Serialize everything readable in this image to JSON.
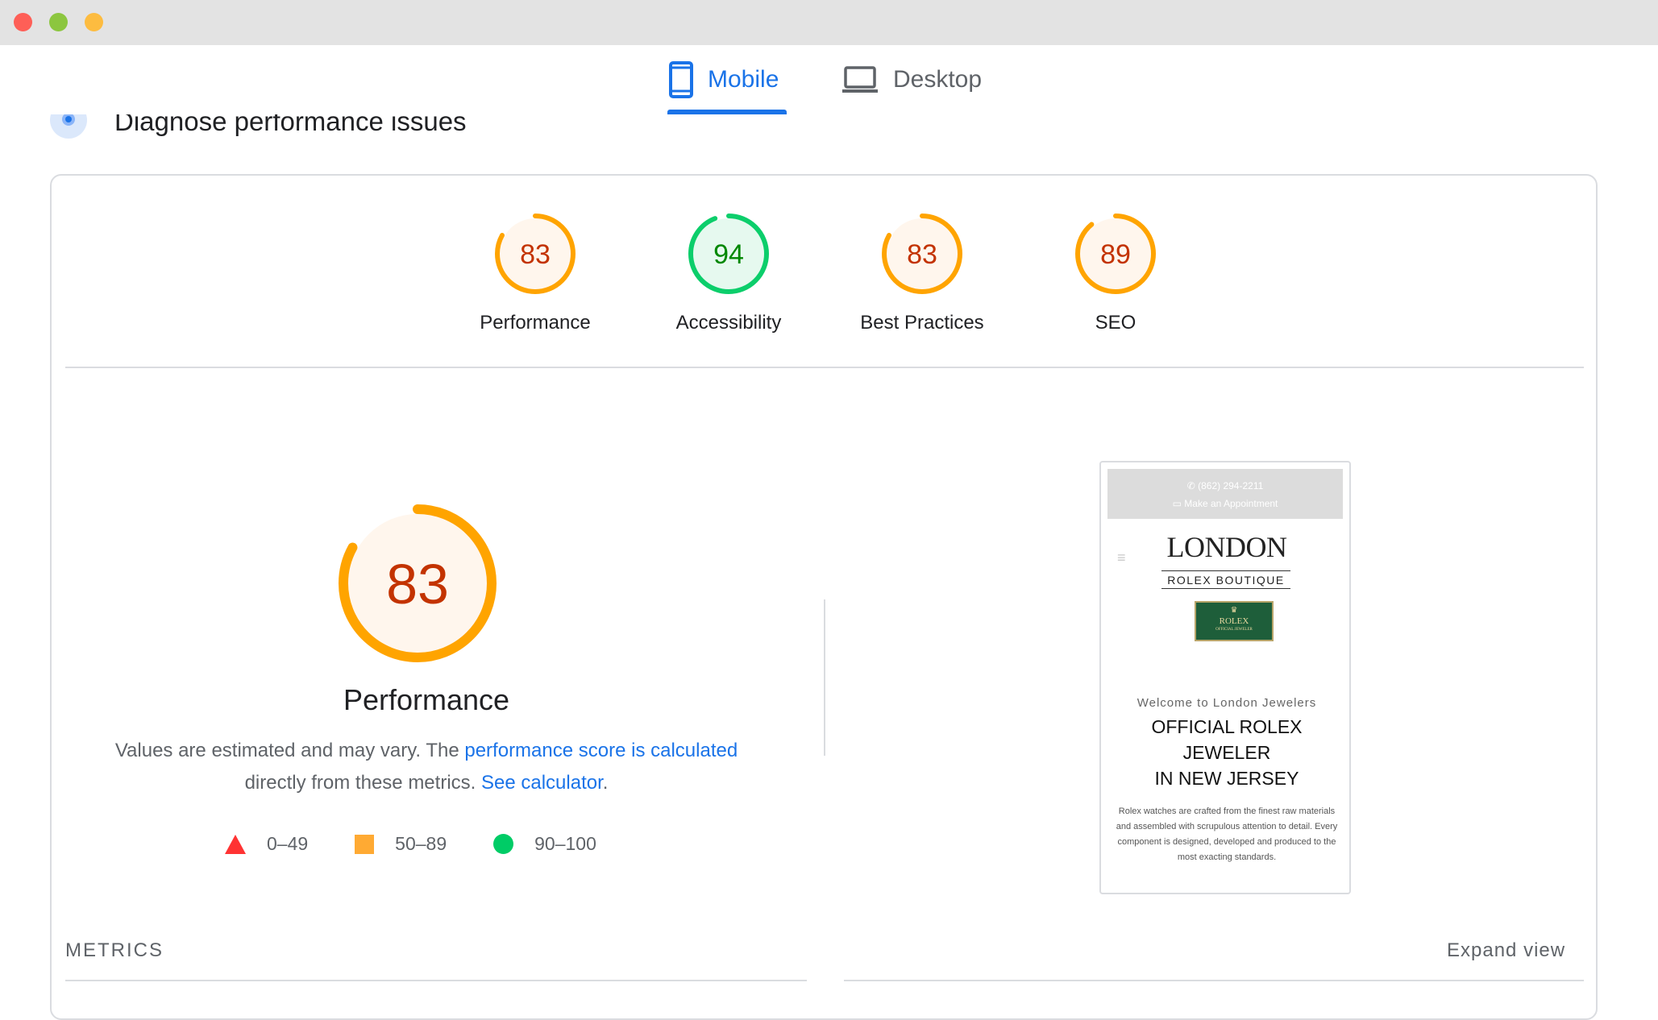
{
  "window": {
    "traffic_lights": [
      "close",
      "minimize",
      "maximize"
    ]
  },
  "tabs": [
    {
      "label": "Mobile",
      "icon": "mobile-phone-icon",
      "active": true
    },
    {
      "label": "Desktop",
      "icon": "laptop-icon",
      "active": false
    }
  ],
  "section": {
    "title": "Diagnose performance issues",
    "icon": "pulse-dot-icon"
  },
  "scores": [
    {
      "label": "Performance",
      "value": "83",
      "score": 83,
      "rating": "average"
    },
    {
      "label": "Accessibility",
      "value": "94",
      "score": 94,
      "rating": "pass"
    },
    {
      "label": "Best Practices",
      "value": "83",
      "score": 83,
      "rating": "average"
    },
    {
      "label": "SEO",
      "value": "89",
      "score": 89,
      "rating": "average"
    }
  ],
  "performance": {
    "value": "83",
    "score": 83,
    "title": "Performance",
    "desc_prefix": "Values are estimated and may vary. The ",
    "desc_link": "performance score is calculated",
    "desc_middle": " directly from these metrics. ",
    "calc_link": "See calculator",
    "desc_suffix": "."
  },
  "legend": [
    {
      "range": "0–49",
      "shape": "triangle",
      "color": "#ff3333"
    },
    {
      "range": "50–89",
      "shape": "square",
      "color": "#ffaa33"
    },
    {
      "range": "90–100",
      "shape": "circle",
      "color": "#00cc66"
    }
  ],
  "colors": {
    "accent": "#1a73e8",
    "average_stroke": "#ffa400",
    "average_text": "#c33300",
    "average_fill": "#fff6ed",
    "pass_stroke": "#0cce6b",
    "pass_text": "#008800",
    "pass_fill": "#e6f9ef"
  },
  "preview": {
    "phone": "(862) 294-2211",
    "appointment": "Make an Appointment",
    "logo_main": "LONDON",
    "logo_sub": "ROLEX BOUTIQUE",
    "badge_name": "ROLEX",
    "badge_sub": "OFFICIAL JEWELER",
    "welcome": "Welcome to London Jewelers",
    "headline_1": "OFFICIAL ROLEX",
    "headline_2": "JEWELER",
    "headline_3": "IN NEW JERSEY",
    "body": "Rolex watches are crafted from the finest raw materials and assembled with scrupulous attention to detail. Every component is designed, developed and produced to the most exacting standards."
  },
  "metrics": {
    "title": "METRICS",
    "expand_label": "Expand view"
  }
}
